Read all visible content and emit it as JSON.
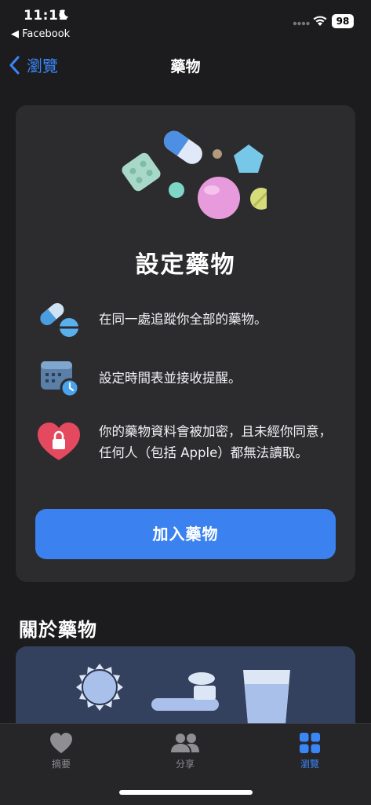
{
  "status_bar": {
    "time": "11:11",
    "back_app": "◀ Facebook",
    "battery": "98"
  },
  "nav": {
    "back_label": "瀏覽",
    "title": "藥物"
  },
  "card": {
    "title": "設定藥物",
    "features": [
      {
        "icon": "pill-icon",
        "text": "在同一處追蹤你全部的藥物。"
      },
      {
        "icon": "calendar-clock-icon",
        "text": "設定時間表並接收提醒。"
      },
      {
        "icon": "heart-lock-icon",
        "text": "你的藥物資料會被加密，且未經你同意，任何人（包括 Apple）都無法讀取。"
      }
    ],
    "button_label": "加入藥物"
  },
  "about": {
    "title": "關於藥物"
  },
  "tabbar": {
    "tabs": [
      {
        "label": "摘要",
        "icon": "heart-icon",
        "selected": false
      },
      {
        "label": "分享",
        "icon": "people-icon",
        "selected": false
      },
      {
        "label": "瀏覽",
        "icon": "grid-icon",
        "selected": true
      }
    ]
  },
  "colors": {
    "accent": "#3b86f7",
    "button": "#3b82f0",
    "background": "#1c1c1e",
    "card": "#2c2c2e"
  }
}
